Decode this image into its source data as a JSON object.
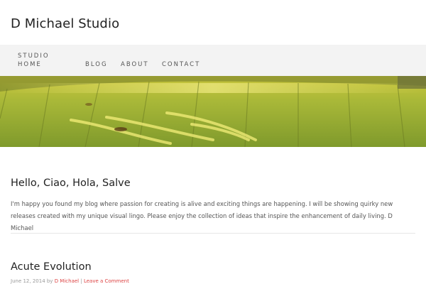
{
  "site": {
    "title": "D Michael Studio"
  },
  "nav": {
    "home": "STUDIO HOME",
    "blog": "BLOG",
    "about": "ABOUT",
    "contact": "CONTACT"
  },
  "posts": [
    {
      "title": "Hello, Ciao, Hola, Salve",
      "body": "I'm happy you found my blog where passion for creating is alive and exciting things are happening. I will be showing quirky new releases created with my unique visual lingo. Please enjoy the collection of ideas that inspire the enhancement of daily living. D Michael"
    },
    {
      "title": "Acute Evolution",
      "meta_date": "June 12, 2014 by",
      "meta_author": "D Michael",
      "meta_sep": "|",
      "meta_comment": "Leave a Comment"
    }
  ],
  "colors": {
    "nav_bg": "#f3f3f3",
    "link_red": "#dd4444",
    "hero_green": "#9fb03a"
  }
}
